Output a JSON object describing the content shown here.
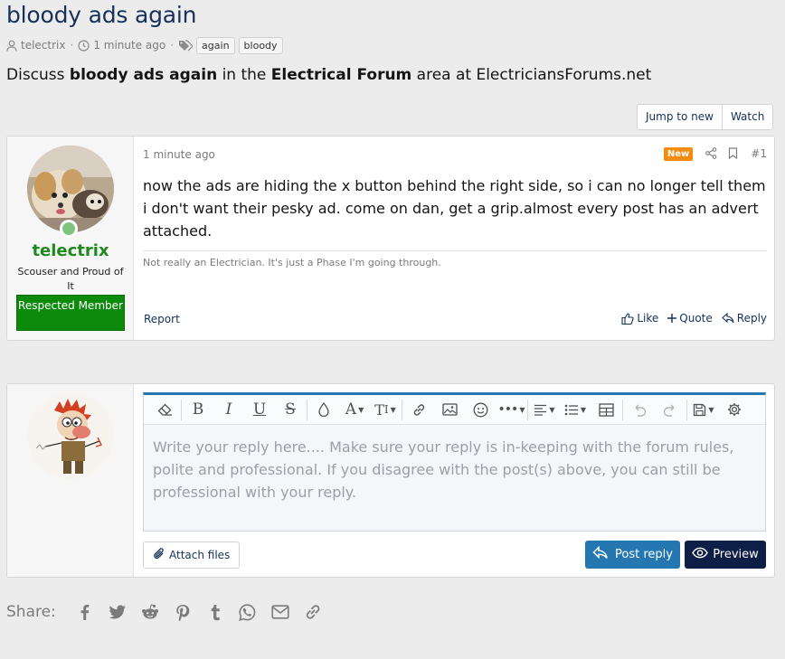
{
  "thread": {
    "title": "bloody ads again",
    "author": "telectrix",
    "time": "1 minute ago",
    "tags": [
      "again",
      "bloody"
    ]
  },
  "description": {
    "prefix": "Discuss ",
    "thread_name": "bloody ads again",
    "middle": " in the ",
    "forum_name": "Electrical Forum",
    "suffix": " area at ElectriciansForums.net"
  },
  "thread_actions": {
    "jump_label": "Jump to new",
    "watch_label": "Watch"
  },
  "post": {
    "date": "1 minute ago",
    "badge": "New",
    "number": "#1",
    "username": "telectrix",
    "user_title": "Scouser and Proud of It",
    "banner": "Respected Member",
    "body": "now the ads are hiding the x button behind the right side, so i can no longer tell them i don't want their pesky ad. come on dan, get a grip.almost every post has an advert attached.",
    "signature": "Not really an Electrician. It's just a Phase I'm going through.",
    "report_label": "Report",
    "like_label": "Like",
    "quote_label": "Quote",
    "reply_label": "Reply"
  },
  "reply_form": {
    "placeholder": "Write your reply here.... Make sure your reply is in-keeping with the forum rules, polite and professional. If you disagree with the post(s) above, you can still be professional with your reply.",
    "attach_label": "Attach files",
    "post_reply_label": "Post reply",
    "preview_label": "Preview",
    "toolbar": [
      "eraser-icon",
      "bold-icon",
      "italic-icon",
      "underline-icon",
      "strike-icon",
      "ink-drop-icon",
      "font-family-icon",
      "font-size-icon",
      "link-icon",
      "image-icon",
      "smiley-icon",
      "more-icon",
      "align-icon",
      "list-icon",
      "table-icon",
      "undo-icon",
      "redo-icon",
      "drafts-icon",
      "settings-icon"
    ]
  },
  "share": {
    "label": "Share:",
    "icons": [
      "facebook-icon",
      "twitter-icon",
      "reddit-icon",
      "pinterest-icon",
      "tumblr-icon",
      "whatsapp-icon",
      "email-icon",
      "link-icon"
    ]
  },
  "colors": {
    "link": "#16315a",
    "accent": "#2577b1",
    "online": "#7ec37e",
    "username": "#1e8a1e",
    "banner": "#0c8a0c",
    "new_badge": "#f28b0e",
    "preview": "#0d1e47"
  }
}
